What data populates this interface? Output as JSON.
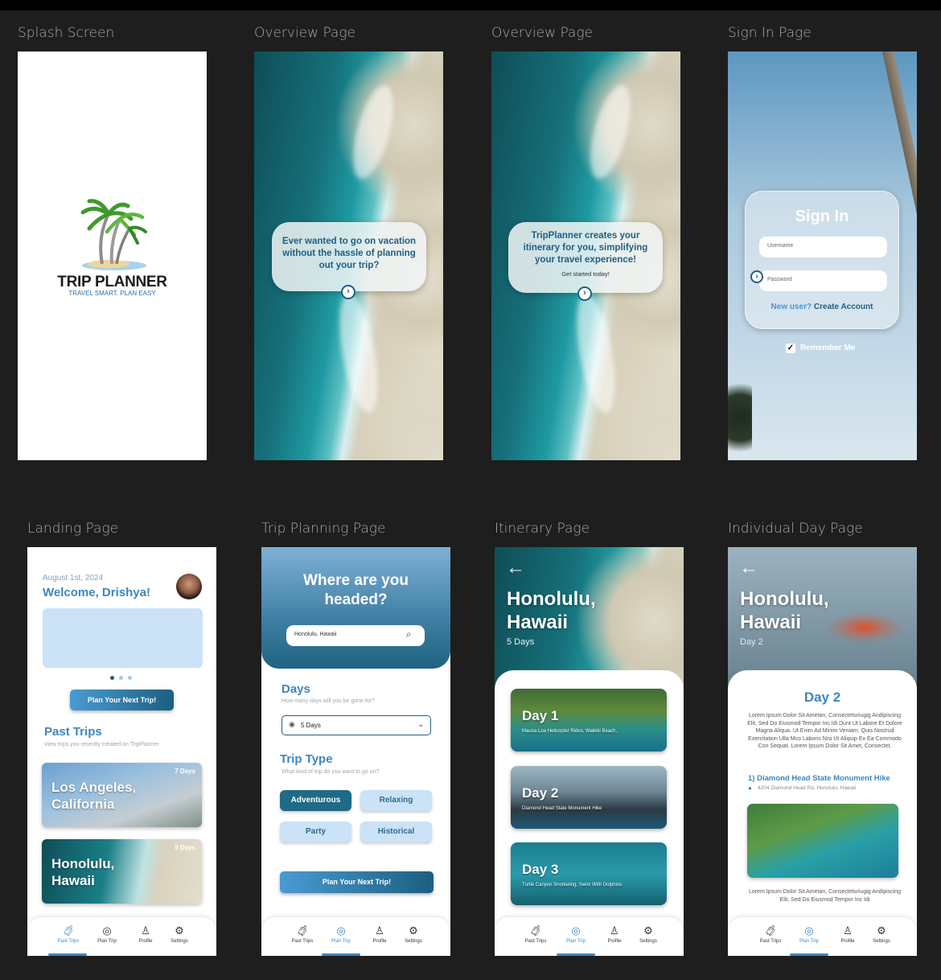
{
  "frames": {
    "splash": "Splash Screen",
    "overview1": "Overview Page",
    "overview2": "Overview Page",
    "signin": "Sign In Page",
    "landing": "Landing Page",
    "planning": "Trip Planning Page",
    "itinerary": "Itinerary Page",
    "dayview": "Individual Day Page"
  },
  "splash": {
    "logo_title": "TRIP PLANNER",
    "tagline": "TRAVEL SMART. PLAN EASY"
  },
  "overview1": {
    "text": "Ever wanted to go on vacation without the hassle of planning out your trip?"
  },
  "overview2": {
    "text": "TripPlanner creates your itinerary for you, simplifying your travel experience!",
    "sub": "Get started today!"
  },
  "signin": {
    "title": "Sign In",
    "username_placeholder": "Username",
    "password_placeholder": "Password",
    "new_user": "New user?",
    "create": "Create Account",
    "remember": "Remember Me"
  },
  "landing": {
    "date": "August 1st, 2024",
    "welcome": "Welcome, Drishya!",
    "plan_btn": "Plan Your Next Trip!",
    "past_title": "Past Trips",
    "past_sub": "View trips you recently created on TripPlanner",
    "trips": [
      {
        "city": "Los Angeles, California",
        "days": "7 Days"
      },
      {
        "city": "Honolulu, Hawaii",
        "days": "5 Days"
      }
    ]
  },
  "planning": {
    "title": "Where are you headed?",
    "search_value": "Honolulu, Hawaii",
    "days_title": "Days",
    "days_sub": "How many days will you be gone for?",
    "days_value": "5 Days",
    "type_title": "Trip Type",
    "type_sub": "What kind of trip do you want to go on?",
    "types": [
      "Adventurous",
      "Relaxing",
      "Party",
      "Historical"
    ],
    "plan_btn": "Plan Your Next Trip!"
  },
  "itinerary": {
    "city": "Honolulu, Hawaii",
    "days": "5 Days",
    "day_cards": [
      {
        "title": "Day 1",
        "sub": "Mauna Loa Helicopter Rides, Waikiki Beach,"
      },
      {
        "title": "Day 2",
        "sub": "Diamond Head State Monument Hike"
      },
      {
        "title": "Day 3",
        "sub": "Turtle Canyon Snorkeling, Swim With Dolphins"
      }
    ]
  },
  "dayview": {
    "city": "Honolulu, Hawaii",
    "day": "Day 2",
    "heading": "Day 2",
    "lorem": "Lorem Ipsum Dolor Sit Ametan, Consecteturiugig Andipiscing Elit, Sed Do Eiusmod Tempor Inc Idi Dunt Ut Labore Et Dolore Magna Aliqua. Ut Enim Ad Minim Veniam, Quis Nostrud Exercitation Ulla Mco Laboris Nisi Ut Aliquip Ex Ea Commodo Con Sequat. Lorem Ipsum Dolor Sit Amet, Consectet.",
    "activity": "1) Diamond Head State Monument Hike",
    "address": "4204 Diamond Head Rd, Honolulu, Hawaii",
    "lorem2": "Lorem Ipsum Dolor Sit Ametan, Consecteturiugig Andipiscing Elit, Sed Do Eiusmod Tempor Inc Idi"
  },
  "nav": {
    "past": "Past Trips",
    "plan": "Plan Trip",
    "profile": "Profile",
    "settings": "Settings"
  }
}
